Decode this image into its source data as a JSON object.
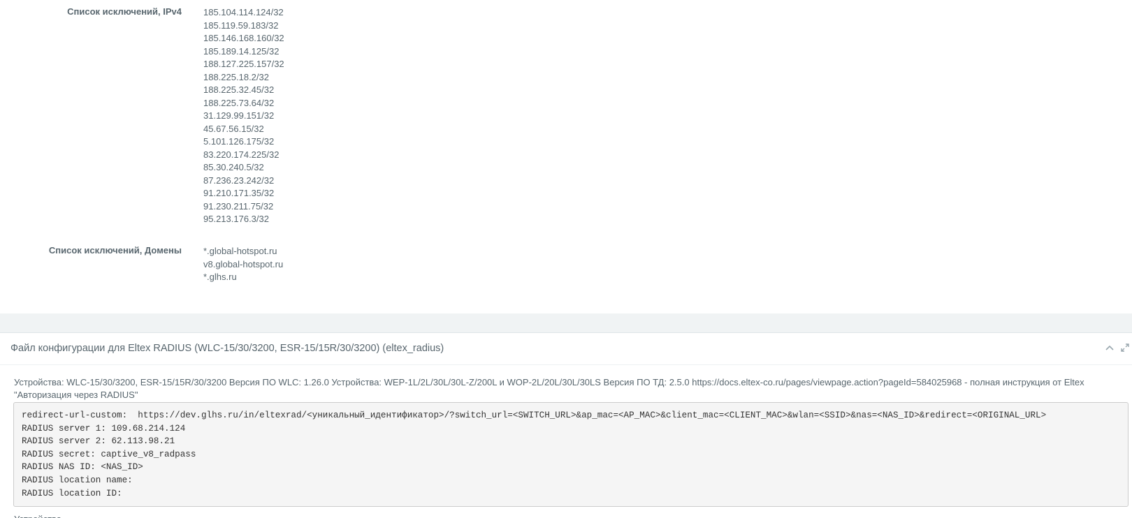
{
  "exclusions_ipv4": {
    "label": "Список исключений, IPv4",
    "values": [
      "185.104.114.124/32",
      "185.119.59.183/32",
      "185.146.168.160/32",
      "185.189.14.125/32",
      "188.127.225.157/32",
      "188.225.18.2/32",
      "188.225.32.45/32",
      "188.225.73.64/32",
      "31.129.99.151/32",
      "45.67.56.15/32",
      "5.101.126.175/32",
      "83.220.174.225/32",
      "85.30.240.5/32",
      "87.236.23.242/32",
      "91.210.171.35/32",
      "91.230.211.75/32",
      "95.213.176.3/32"
    ]
  },
  "exclusions_domains": {
    "label": "Список исключений, Домены",
    "values": [
      "*.global-hotspot.ru",
      "v8.global-hotspot.ru",
      "*.glhs.ru"
    ]
  },
  "config_panel": {
    "title": "Файл конфигурации для Eltex RADIUS (WLC-15/30/3200, ESR-15/15R/30/3200) (eltex_radius)",
    "collapse_icon": "chevron-up-icon",
    "expand_icon": "expand-icon",
    "description": "Устройства: WLC-15/30/3200, ESR-15/15R/30/3200 Версия ПО WLC: 1.26.0 Устройства: WEP-1L/2L/30L/30L-Z/200L и WOP-2L/20L/30L/30LS Версия ПО ТД: 2.5.0 https://docs.eltex-co.ru/pages/viewpage.action?pageId=584025968 - полная инструкция от Eltex \"Авторизация через RADIUS\"",
    "code_lines": [
      "redirect-url-custom:  https://dev.glhs.ru/in/eltexrad/<уникальный_идентификатор>/?switch_url=<SWITCH_URL>&ap_mac=<AP_MAC>&client_mac=<CLIENT_MAC>&wlan=<SSID>&nas=<NAS_ID>&redirect=<ORIGINAL_URL>",
      "RADIUS server 1: 109.68.214.124",
      "RADIUS server 2: 62.113.98.21",
      "RADIUS secret: captive_v8_radpass",
      "RADIUS NAS ID: <NAS_ID>",
      "RADIUS location name:",
      "RADIUS location ID:"
    ],
    "cut_text": "Устройства"
  }
}
